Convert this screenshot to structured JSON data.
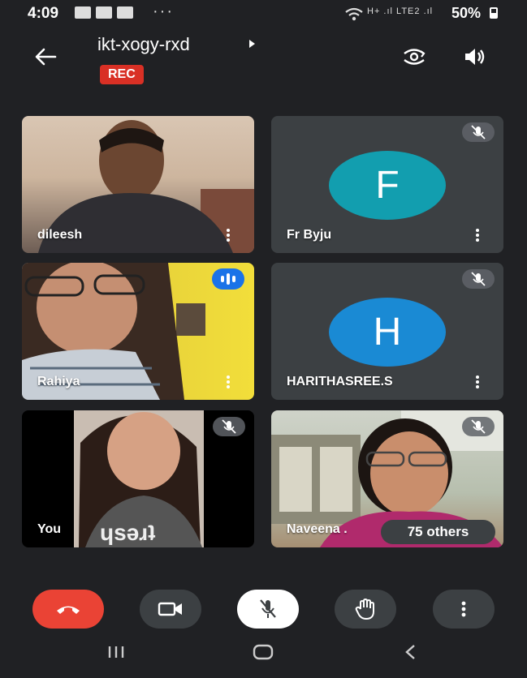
{
  "status_bar": {
    "time": "4:09",
    "overflow": "···",
    "signal": "H+ .ıl LTE2 .ıl",
    "battery": "50%"
  },
  "header": {
    "meeting_code": "ikt-xogy-rxd",
    "rec_badge": "REC",
    "icons": [
      "back-arrow-icon",
      "switch-camera-icon",
      "speaker-icon"
    ]
  },
  "tiles": [
    {
      "name": "dileesh",
      "type": "video",
      "muted": false
    },
    {
      "name": "Fr Byju",
      "type": "avatar",
      "initial": "F",
      "avatar_color": "#129eaf",
      "muted": true
    },
    {
      "name": "Rahiya",
      "type": "video",
      "muted": false,
      "speaking": true
    },
    {
      "name": "HARITHASREE.S",
      "type": "avatar",
      "initial": "H",
      "avatar_color": "#1a8ad4",
      "muted": true
    },
    {
      "name": "You",
      "type": "video",
      "muted": true
    },
    {
      "name": "Naveena .",
      "type": "video",
      "muted": true
    }
  ],
  "others_chip": "75 others",
  "controls": {
    "end_call_color": "#ea4335",
    "icons": [
      "end-call-icon",
      "camera-icon",
      "mic-off-icon",
      "raise-hand-icon",
      "more-options-icon"
    ]
  },
  "nav_bar": [
    "recent-apps-icon",
    "home-icon",
    "back-icon"
  ]
}
